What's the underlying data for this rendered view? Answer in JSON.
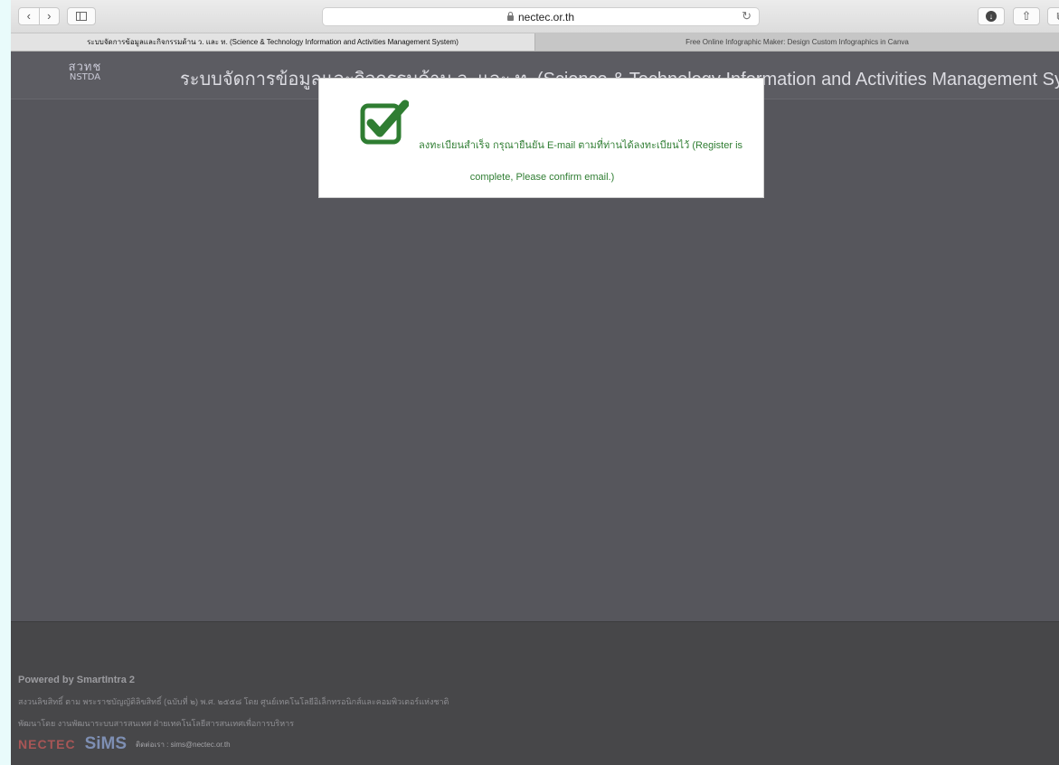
{
  "browser": {
    "url": "nectec.or.th",
    "back_icon": "chevron-left-icon",
    "forward_icon": "chevron-right-icon",
    "tabs": [
      {
        "label": "ระบบจัดการข้อมูลและกิจกรรมด้าน ว. และ ท. (Science & Technology Information and Activities Management System)",
        "active": true
      },
      {
        "label": "Free Online Infographic Maker: Design Custom Infographics in Canva",
        "active": false
      }
    ]
  },
  "header": {
    "logo_line1": "สวทช",
    "logo_line2": "NSTDA",
    "title": "ระบบจัดการข้อมูลและกิจกรรมด้าน ว. และ ท. (Science & Technology Information and Activities Management System)"
  },
  "modal": {
    "icon": "checkbox-checked-icon",
    "message_line1": "ลงทะเบียนสำเร็จ กรุณายืนยัน E-mail ตามที่ท่านได้ลงทะเบียนไว้ (Register is",
    "message_line2": "complete, Please confirm email.)",
    "accent_color": "#2f7d32"
  },
  "footer": {
    "powered_by": "Powered by SmartIntra 2",
    "copyright": "สงวนลิขสิทธิ์ ตาม พระราชบัญญัติลิขสิทธิ์ (ฉบับที่ ๒) พ.ศ. ๒๕๕๘ โดย ศูนย์เทคโนโลยีอิเล็กทรอนิกส์และคอมพิวเตอร์แห่งชาติ",
    "developed_by": "พัฒนาโดย งานพัฒนาระบบสารสนเทศ ฝ่ายเทคโนโลยีสารสนเทศเพื่อการบริหาร",
    "nectec_logo": "NECTEC",
    "sims_logo": "SiMS",
    "contact": "ติดต่อเรา : sims@nectec.or.th"
  }
}
